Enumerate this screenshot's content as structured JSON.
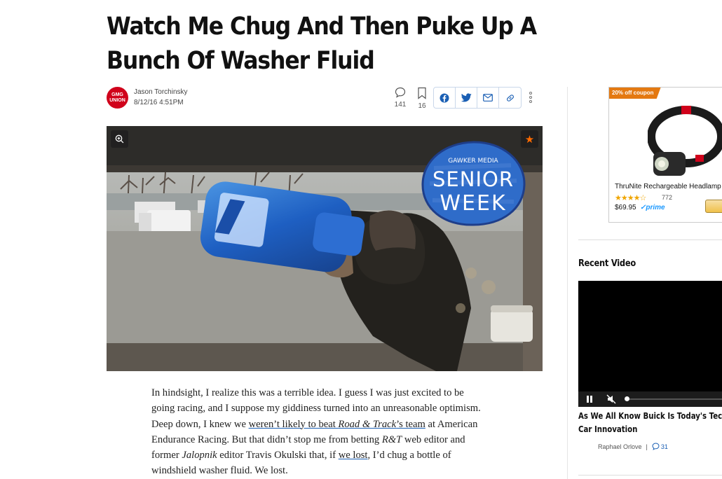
{
  "article": {
    "title": "Watch Me Chug And Then Puke Up A Bunch Of Washer Fluid",
    "union_badge": "GMG UNION",
    "author": "Jason Torchinsky",
    "date": "8/12/16 4:51PM",
    "comment_count": "141",
    "bookmark_count": "16",
    "badge_text": "GAWKER MEDIA SENIOR WEEK",
    "body": {
      "t1": "In hindsight, I realize this was a terrible idea. I guess I was just excited to be going racing, and I suppose my giddiness turned into an unreasonable optimism. Deep down, I knew we ",
      "link1_a": "weren’t likely to beat ",
      "link1_b": "Road & Track",
      "link1_c": "’s team",
      "t2": " at American Endurance Racing. But that didn’t stop me from betting ",
      "rt": "R&T",
      "t3": " web editor and former ",
      "jalopnik": "Jalopnik",
      "t4": " editor Travis Okulski that, if ",
      "link2": "we lost",
      "t5": ", I’d chug a bottle of windshield washer fluid. We lost."
    }
  },
  "ad": {
    "coupon": "20% off coupon",
    "title": "ThruNite Rechargeable Headlamp",
    "rating_count": "772",
    "stars": "★★★★☆",
    "price": "$69.95",
    "prime": "✓prime"
  },
  "sidebar": {
    "recent_video_title": "Recent Video",
    "video_title_line1": "As We All Know Buick Is Today's Technology",
    "video_title_line2": "Car Innovation",
    "video_author": "Raphael Orlove",
    "video_comments": "31"
  },
  "colors": {
    "accent": "#1a5fb4",
    "union_red": "#d0021b",
    "star_orange": "#ff6b00",
    "coupon_orange": "#e47911"
  }
}
